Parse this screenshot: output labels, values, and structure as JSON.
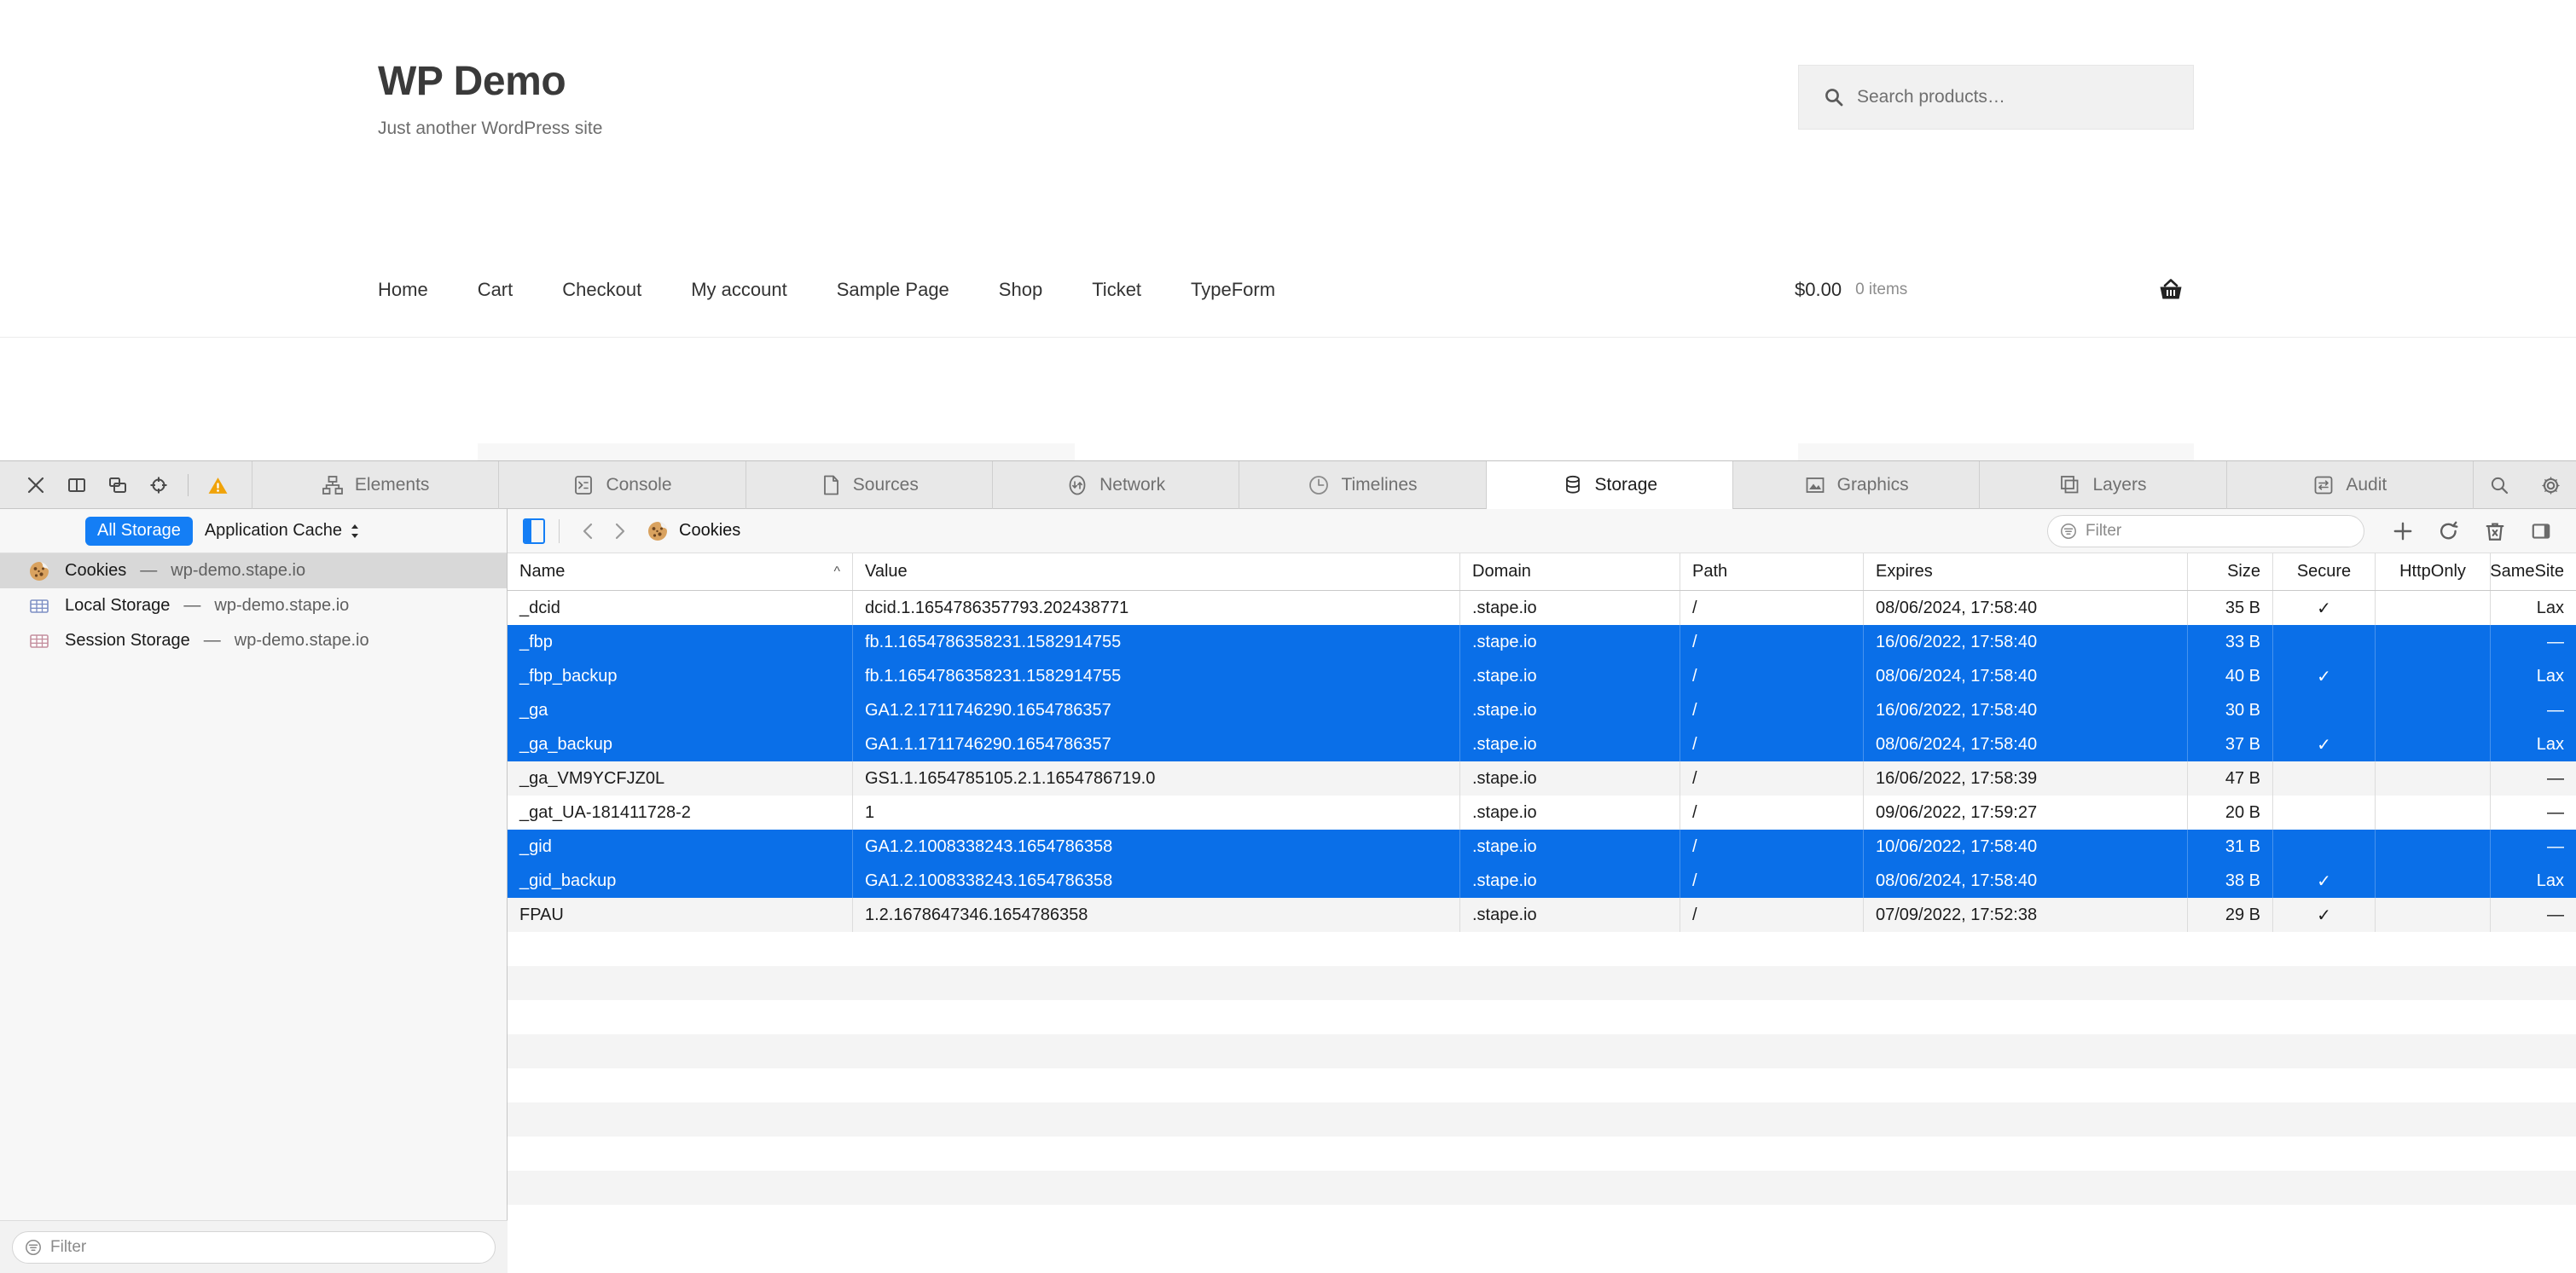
{
  "webpage": {
    "site_title": "WP Demo",
    "site_description": "Just another WordPress site",
    "search": {
      "placeholder": "Search products…",
      "icon": "search-icon"
    },
    "nav_items": [
      {
        "label": "Home"
      },
      {
        "label": "Cart"
      },
      {
        "label": "Checkout"
      },
      {
        "label": "My account"
      },
      {
        "label": "Sample Page"
      },
      {
        "label": "Shop"
      },
      {
        "label": "Ticket"
      },
      {
        "label": "TypeForm"
      }
    ],
    "cart": {
      "total": "$0.00",
      "count": "0 items",
      "icon": "basket-icon"
    }
  },
  "inspector": {
    "toolbar_left_icons": [
      {
        "name": "close-icon"
      },
      {
        "name": "dock-split-icon"
      },
      {
        "name": "dock-detach-icon"
      },
      {
        "name": "element-selector-icon"
      },
      {
        "name": "warning-icon"
      }
    ],
    "tabs": [
      {
        "label": "Elements",
        "icon": "elements-icon",
        "active": false
      },
      {
        "label": "Console",
        "icon": "console-icon",
        "active": false
      },
      {
        "label": "Sources",
        "icon": "sources-icon",
        "active": false
      },
      {
        "label": "Network",
        "icon": "network-icon",
        "active": false
      },
      {
        "label": "Timelines",
        "icon": "timelines-icon",
        "active": false
      },
      {
        "label": "Storage",
        "icon": "storage-icon",
        "active": true
      },
      {
        "label": "Graphics",
        "icon": "graphics-icon",
        "active": false
      },
      {
        "label": "Layers",
        "icon": "layers-icon",
        "active": false
      },
      {
        "label": "Audit",
        "icon": "audit-icon",
        "active": false
      }
    ],
    "toolbar_right_icons": [
      {
        "name": "search-icon"
      },
      {
        "name": "gear-icon"
      }
    ],
    "sidebar": {
      "scope_pill": "All Storage",
      "scope_select": "Application Cache",
      "items": [
        {
          "label": "Cookies",
          "dash": "—",
          "host": "wp-demo.stape.io",
          "icon": "cookie-icon",
          "selected": true
        },
        {
          "label": "Local Storage",
          "dash": "—",
          "host": "wp-demo.stape.io",
          "icon": "table-grid-blue-icon",
          "selected": false
        },
        {
          "label": "Session Storage",
          "dash": "—",
          "host": "wp-demo.stape.io",
          "icon": "table-grid-pink-icon",
          "selected": false
        }
      ],
      "filter_placeholder": "Filter"
    },
    "content": {
      "breadcrumb": "Cookies",
      "breadcrumb_icon": "cookie-icon",
      "filter_placeholder": "Filter",
      "nav_icons": [
        {
          "name": "sidebar-toggle-icon"
        },
        {
          "name": "chevron-left-icon"
        },
        {
          "name": "chevron-right-icon"
        }
      ],
      "action_icons": [
        {
          "name": "add-icon"
        },
        {
          "name": "refresh-icon"
        },
        {
          "name": "trash-icon"
        },
        {
          "name": "details-panel-toggle-icon"
        }
      ]
    }
  },
  "table": {
    "columns": [
      {
        "key": "name",
        "label": "Name",
        "sorted": true,
        "sort_dir": "asc"
      },
      {
        "key": "value",
        "label": "Value",
        "sorted": false
      },
      {
        "key": "domain",
        "label": "Domain",
        "sorted": false
      },
      {
        "key": "path",
        "label": "Path",
        "sorted": false
      },
      {
        "key": "expires",
        "label": "Expires",
        "sorted": false
      },
      {
        "key": "size",
        "label": "Size",
        "sorted": false
      },
      {
        "key": "secure",
        "label": "Secure",
        "sorted": false
      },
      {
        "key": "http",
        "label": "HttpOnly",
        "sorted": false
      },
      {
        "key": "same",
        "label": "SameSite",
        "sorted": false
      }
    ],
    "rows": [
      {
        "name": "_dcid",
        "value": "dcid.1.1654786357793.202438771",
        "domain": ".stape.io",
        "path": "/",
        "expires": "08/06/2024, 17:58:40",
        "size": "35 B",
        "secure": "✓",
        "http": "",
        "same": "Lax",
        "selected": false
      },
      {
        "name": "_fbp",
        "value": "fb.1.1654786358231.1582914755",
        "domain": ".stape.io",
        "path": "/",
        "expires": "16/06/2022, 17:58:40",
        "size": "33 B",
        "secure": "",
        "http": "",
        "same": "—",
        "selected": true
      },
      {
        "name": "_fbp_backup",
        "value": "fb.1.1654786358231.1582914755",
        "domain": ".stape.io",
        "path": "/",
        "expires": "08/06/2024, 17:58:40",
        "size": "40 B",
        "secure": "✓",
        "http": "",
        "same": "Lax",
        "selected": true
      },
      {
        "name": "_ga",
        "value": "GA1.2.1711746290.1654786357",
        "domain": ".stape.io",
        "path": "/",
        "expires": "16/06/2022, 17:58:40",
        "size": "30 B",
        "secure": "",
        "http": "",
        "same": "—",
        "selected": true
      },
      {
        "name": "_ga_backup",
        "value": "GA1.1.1711746290.1654786357",
        "domain": ".stape.io",
        "path": "/",
        "expires": "08/06/2024, 17:58:40",
        "size": "37 B",
        "secure": "✓",
        "http": "",
        "same": "Lax",
        "selected": true
      },
      {
        "name": "_ga_VM9YCFJZ0L",
        "value": "GS1.1.1654785105.2.1.1654786719.0",
        "domain": ".stape.io",
        "path": "/",
        "expires": "16/06/2022, 17:58:39",
        "size": "47 B",
        "secure": "",
        "http": "",
        "same": "—",
        "selected": false
      },
      {
        "name": "_gat_UA-181411728-2",
        "value": "1",
        "domain": ".stape.io",
        "path": "/",
        "expires": "09/06/2022, 17:59:27",
        "size": "20 B",
        "secure": "",
        "http": "",
        "same": "—",
        "selected": false
      },
      {
        "name": "_gid",
        "value": "GA1.2.1008338243.1654786358",
        "domain": ".stape.io",
        "path": "/",
        "expires": "10/06/2022, 17:58:40",
        "size": "31 B",
        "secure": "",
        "http": "",
        "same": "—",
        "selected": true
      },
      {
        "name": "_gid_backup",
        "value": "GA1.2.1008338243.1654786358",
        "domain": ".stape.io",
        "path": "/",
        "expires": "08/06/2024, 17:58:40",
        "size": "38 B",
        "secure": "✓",
        "http": "",
        "same": "Lax",
        "selected": true
      },
      {
        "name": "FPAU",
        "value": "1.2.1678647346.1654786358",
        "domain": ".stape.io",
        "path": "/",
        "expires": "07/09/2022, 17:52:38",
        "size": "29 B",
        "secure": "✓",
        "http": "",
        "same": "—",
        "selected": false
      }
    ],
    "empty_row_count": 8
  },
  "colors": {
    "selection_blue": "#0a6fe8",
    "pill_blue": "#147ef5",
    "toolbar_bg": "#e8e8e8",
    "sidebar_bg": "#f7f7f7",
    "zebra": "#f4f4f4",
    "warning_amber": "#f0a30a"
  }
}
